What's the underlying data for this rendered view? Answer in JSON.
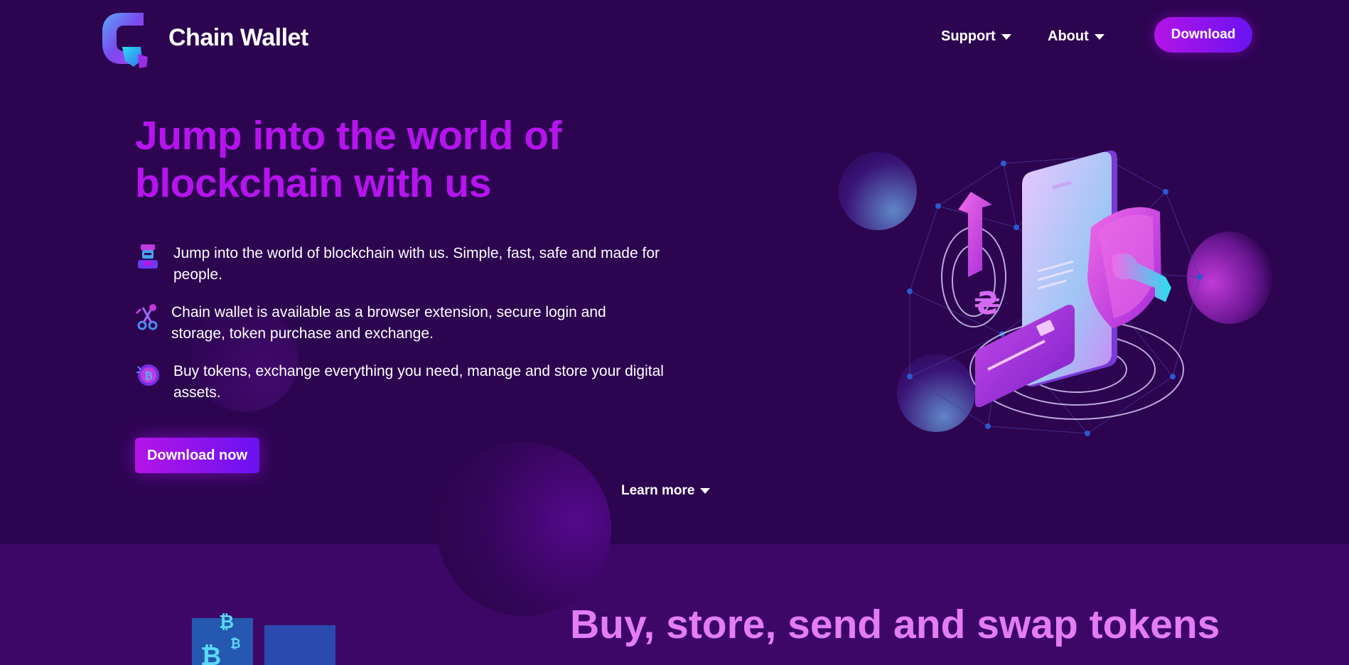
{
  "brand": {
    "name": "Chain Wallet"
  },
  "nav": {
    "support": "Support",
    "about": "About",
    "download": "Download"
  },
  "hero": {
    "headline": "Jump into the world of blockchain with us",
    "features": [
      {
        "icon": "robot-icon",
        "text": "Jump into the world of blockchain with us. Simple, fast, safe and made for people."
      },
      {
        "icon": "tools-icon",
        "text": "Chain wallet is available as a browser extension, secure login and storage, token purchase and exchange."
      },
      {
        "icon": "bitcoin-coin-icon",
        "text": "Buy tokens, exchange everything you need, manage and store your digital assets."
      }
    ],
    "cta": "Download now",
    "learn_more": "Learn more"
  },
  "section2": {
    "title": "Buy, store, send and swap tokens"
  },
  "colors": {
    "background": "#2c0450",
    "section2_background": "#3d0768",
    "accent": "#b614ee",
    "accent_gradient_end": "#6a12f2",
    "section2_title": "#e47cf6"
  }
}
